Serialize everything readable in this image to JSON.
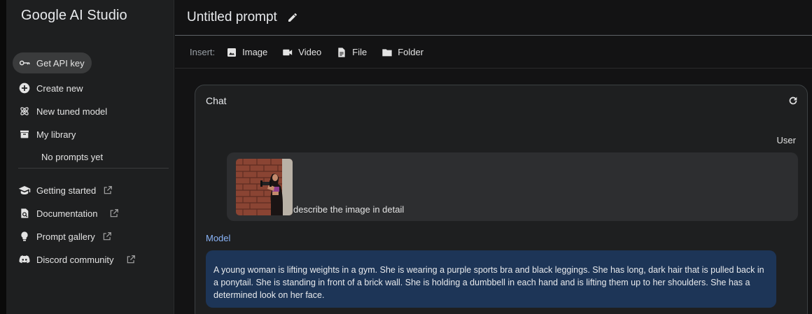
{
  "sidebar": {
    "brand": "Google AI Studio",
    "api_key": "Get API key",
    "create_new": "Create new",
    "new_tuned_model": "New tuned model",
    "my_library": "My library",
    "no_prompts": "No prompts yet",
    "getting_started": "Getting started",
    "documentation": "Documentation",
    "prompt_gallery": "Prompt gallery",
    "discord": "Discord community"
  },
  "header": {
    "title": "Untitled prompt"
  },
  "insert": {
    "label": "Insert:",
    "image": "Image",
    "video": "Video",
    "file": "File",
    "folder": "Folder"
  },
  "chat": {
    "title": "Chat",
    "user_label": "User",
    "user_message": "describe the image in detail",
    "model_label": "Model",
    "model_response": "A young woman is lifting weights in a gym. She is wearing a purple sports bra and black leggings. She has long, dark hair that is pulled back in a ponytail. She is standing in front of a brick wall. She is holding a dumbbell in each hand and is lifting them up to her shoulders. She has a determined look on her face."
  },
  "icons": {
    "key": "key-icon",
    "plus": "add-circle-icon",
    "tuned": "atom-icon",
    "library": "library-icon",
    "school": "graduation-cap-icon",
    "docs": "document-search-icon",
    "bulb": "lightbulb-icon",
    "discord": "discord-icon",
    "external": "external-link-icon",
    "edit": "pencil-icon",
    "refresh": "refresh-icon"
  },
  "colors": {
    "background": "#131314",
    "sidebar": "#1e1f20",
    "model_bubble": "#1d3557",
    "model_label": "#8ab4f8"
  }
}
